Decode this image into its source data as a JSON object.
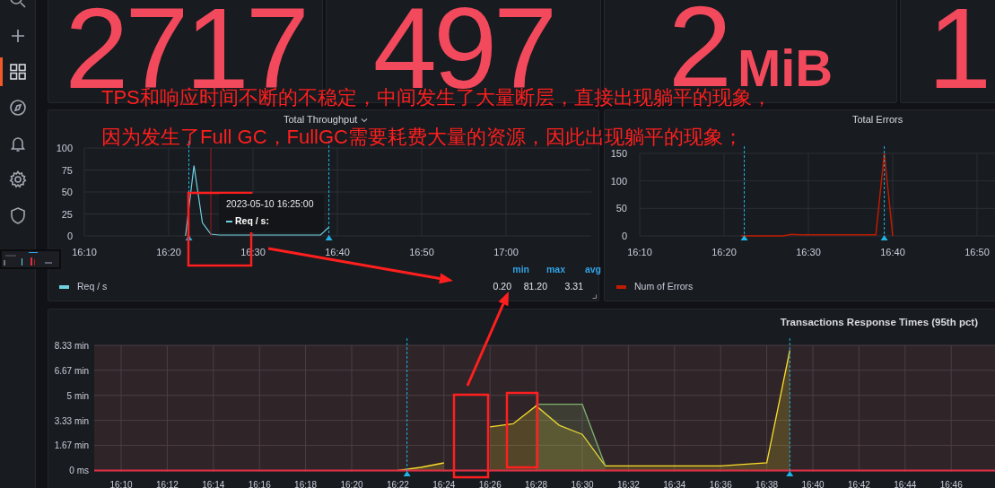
{
  "sidebar": {
    "items": [
      {
        "kind": "search",
        "selected": false
      },
      {
        "kind": "plus",
        "selected": false
      },
      {
        "kind": "dashboards",
        "selected": true
      },
      {
        "kind": "compass",
        "selected": false
      },
      {
        "kind": "bell",
        "selected": false
      },
      {
        "kind": "gear",
        "selected": false
      },
      {
        "kind": "shield",
        "selected": false
      }
    ]
  },
  "stats": [
    {
      "value": "2717"
    },
    {
      "value": "497"
    },
    {
      "value": "2",
      "unit": "MiB"
    },
    {
      "value": "1"
    }
  ],
  "throughput_panel": {
    "title": "Total Throughput",
    "chart_data": {
      "type": "line",
      "categories": [
        "16:10",
        null,
        null,
        null,
        null,
        null,
        null,
        null,
        null,
        null,
        "16:20",
        null,
        null,
        null,
        null,
        null,
        null,
        null,
        null,
        null,
        "16:30",
        null,
        null,
        null,
        null,
        null,
        null,
        null,
        null,
        null,
        "16:40",
        null,
        null,
        null,
        null,
        null,
        null,
        null,
        null,
        null,
        "16:50",
        null,
        null,
        null,
        null,
        null,
        null,
        null,
        null,
        null,
        "17:00",
        null,
        null,
        null,
        null,
        null,
        null
      ],
      "series": [
        {
          "color": "#6ed0e0",
          "values": [
            null,
            null,
            null,
            null,
            null,
            null,
            null,
            null,
            null,
            null,
            null,
            null,
            0,
            80,
            15,
            2,
            1,
            1,
            1,
            1,
            1,
            1,
            1,
            1,
            1,
            1,
            1,
            1,
            1,
            10,
            null,
            null,
            null,
            null,
            null,
            null,
            null,
            null,
            null,
            null,
            null,
            null,
            null,
            null,
            null,
            null,
            null,
            null,
            null,
            null,
            null,
            null,
            null,
            null,
            null,
            null,
            null
          ]
        }
      ],
      "ylim": [
        0,
        100
      ],
      "yticks": [
        0,
        25,
        50,
        75,
        100
      ],
      "grid": true
    },
    "tooltip": {
      "time": "2023-05-10 16:25:00",
      "label": "Req / s:"
    },
    "legend": {
      "headers": [
        "min",
        "max",
        "avg"
      ],
      "items": [
        {
          "name": "Req / s",
          "color": "#6ed0e0",
          "min": "0.20",
          "max": "81.20",
          "avg": "3.31"
        }
      ]
    }
  },
  "errors_panel": {
    "title": "Total Errors",
    "chart_data": {
      "type": "line",
      "categories": [
        "16:10",
        null,
        null,
        null,
        null,
        null,
        null,
        null,
        null,
        null,
        "16:20",
        null,
        null,
        null,
        null,
        null,
        null,
        null,
        null,
        null,
        "16:30",
        null,
        null,
        null,
        null,
        null,
        null,
        null,
        null,
        null,
        "16:40",
        null,
        null,
        null,
        null,
        null,
        null,
        null,
        null,
        null,
        "16:50",
        null,
        null
      ],
      "series": [
        {
          "color": "#bf1b00",
          "values": [
            null,
            null,
            null,
            null,
            null,
            null,
            null,
            null,
            null,
            null,
            null,
            null,
            0,
            0,
            0,
            0,
            0,
            0,
            3,
            2,
            2,
            2,
            2,
            2,
            2,
            2,
            2,
            2,
            2,
            150,
            0,
            null,
            null,
            null,
            null,
            null,
            null,
            null,
            null,
            null,
            null,
            null,
            null
          ]
        }
      ],
      "ylim": [
        0,
        150
      ],
      "yticks": [
        0,
        50,
        100,
        150
      ],
      "grid": true
    },
    "legend": {
      "items": [
        {
          "name": "Num of Errors",
          "color": "#bf1b00"
        }
      ]
    }
  },
  "response_panel": {
    "title": "Transactions Response Times (95th pct)",
    "chart_data": {
      "type": "area",
      "grid": true,
      "categories": [
        null,
        "16:10",
        null,
        "16:12",
        null,
        "16:14",
        null,
        "16:16",
        null,
        "16:18",
        null,
        "16:20",
        null,
        "16:22",
        null,
        "16:24",
        null,
        "16:26",
        null,
        "16:28",
        null,
        "16:30",
        null,
        "16:32",
        null,
        "16:34",
        null,
        "16:36",
        null,
        "16:38",
        null,
        "16:40",
        null,
        "16:42",
        null,
        "16:44",
        null,
        "16:46",
        null
      ],
      "series": [
        {
          "color": "#fade2a",
          "values": [
            null,
            null,
            null,
            null,
            null,
            null,
            null,
            null,
            null,
            null,
            null,
            null,
            null,
            0,
            0.2,
            0.5,
            null,
            2.9,
            3.1,
            4.3,
            3.0,
            2.4,
            0.3,
            0.3,
            0.3,
            0.3,
            0.3,
            0.3,
            0.4,
            0.5,
            8.0,
            null,
            null,
            null,
            null,
            null,
            null,
            null,
            null
          ]
        },
        {
          "color": "#7eb26d",
          "values": [
            null,
            null,
            null,
            null,
            null,
            null,
            null,
            null,
            null,
            null,
            null,
            null,
            null,
            null,
            null,
            null,
            null,
            null,
            null,
            4.4,
            4.4,
            4.4,
            0.3,
            null,
            null,
            null,
            null,
            null,
            null,
            null,
            null,
            null,
            null,
            null,
            null,
            null,
            null,
            null,
            null
          ]
        }
      ],
      "ylim": [
        -0.1,
        8.33
      ],
      "yticks": [
        {
          "value": 0,
          "label": "0 ms"
        },
        {
          "value": 1.67,
          "label": "1.67 min"
        },
        {
          "value": 3.33,
          "label": "3.33 min"
        },
        {
          "value": 5,
          "label": "5 min"
        },
        {
          "value": 6.67,
          "label": "6.67 min"
        },
        {
          "value": 8.33,
          "label": "8.33 min"
        }
      ]
    }
  },
  "annotation": {
    "lines": [
      "TPS和响应时间不断的不稳定，中间发生了大量断层，直接出现躺平的现象，",
      "因为发生了Full GC，FullGC需要耗费大量的资源，因此出现躺平的现象；"
    ]
  }
}
